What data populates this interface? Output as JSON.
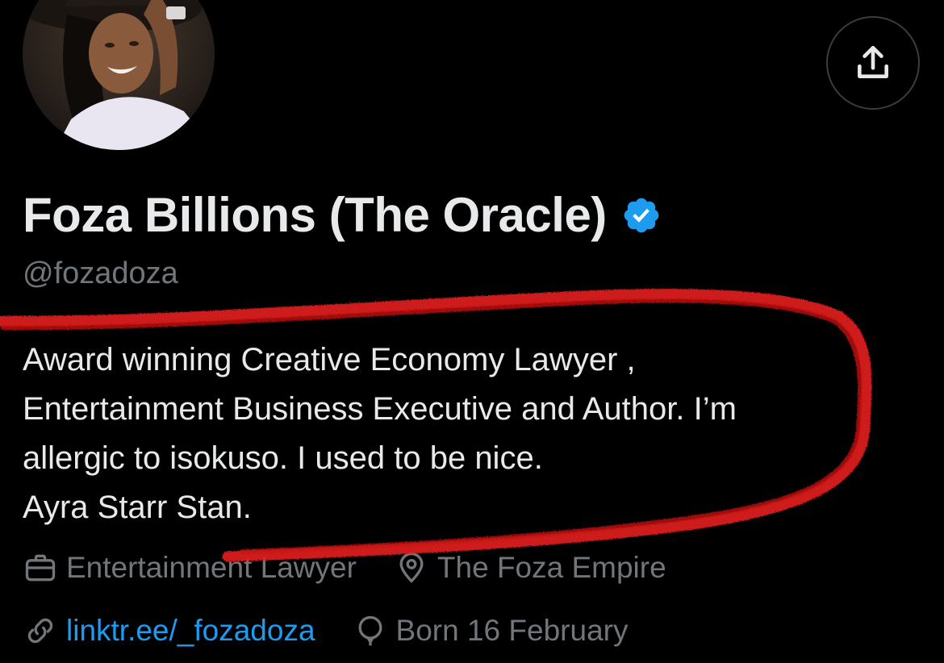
{
  "profile": {
    "display_name": "Foza Billions (The Oracle)",
    "handle": "@fozadoza",
    "bio_lines": [
      "Award winning Creative Economy Lawyer ,",
      "Entertainment Business Executive and Author. I’m",
      "allergic to isokuso. I used to be nice.",
      "Ayra Starr Stan."
    ],
    "profession": "Entertainment Lawyer",
    "location": "The Foza Empire",
    "link": "linktr.ee/_fozadoza",
    "birthday": "Born 16 February"
  },
  "icons": {
    "share": "share-upload-icon",
    "verified": "verified-badge-icon",
    "profession": "briefcase-icon",
    "location": "location-pin-icon",
    "link": "link-icon",
    "birthday": "balloon-icon"
  },
  "colors": {
    "background": "#000000",
    "text_primary": "#e7e9ea",
    "text_secondary": "#71767b",
    "link": "#1d9bf0",
    "verified": "#1d9bf0",
    "annotation": "#e0201c"
  }
}
